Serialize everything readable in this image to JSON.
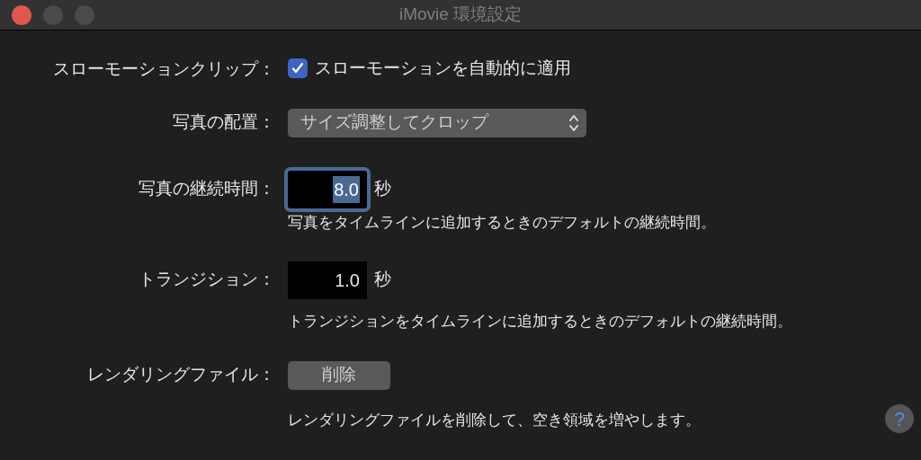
{
  "window": {
    "title": "iMovie 環境設定"
  },
  "rows": [
    {
      "kind": "checkbox",
      "label": "スローモーションクリップ：",
      "checked": true,
      "text": "スローモーションを自動的に適用"
    },
    {
      "kind": "popup",
      "label": "写真の配置：",
      "value": "サイズ調整してクロップ"
    },
    {
      "kind": "number",
      "label": "写真の継続時間：",
      "value": "8.0",
      "focused": true,
      "unit": "秒",
      "description": "写真をタイムラインに追加するときのデフォルトの継続時間。"
    },
    {
      "kind": "number",
      "label": "トランジション：",
      "value": "1.0",
      "focused": false,
      "unit": "秒",
      "description": "トランジションをタイムラインに追加するときのデフォルトの継続時間。"
    },
    {
      "kind": "button",
      "label": "レンダリングファイル：",
      "button": "削除",
      "description": "レンダリングファイルを削除して、空き領域を増やします。"
    }
  ],
  "help": {
    "label": "?"
  }
}
